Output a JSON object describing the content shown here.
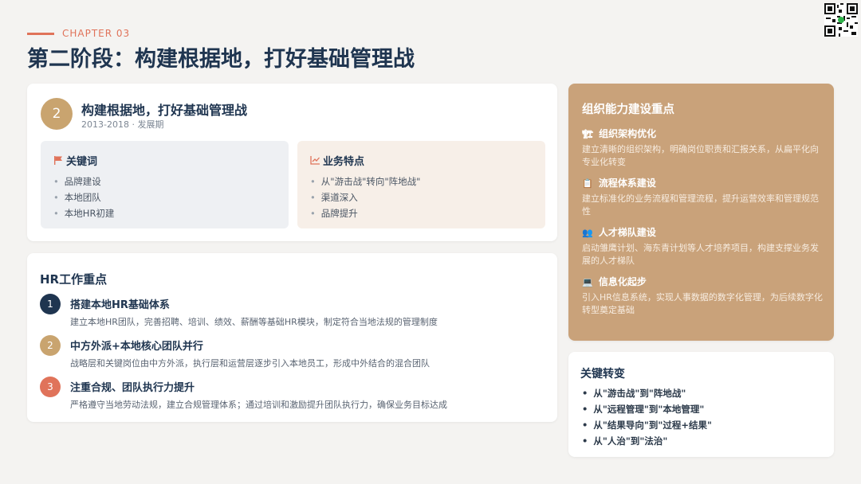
{
  "header": {
    "chapter": "CHAPTER 03",
    "title": "第二阶段：构建根据地，打好基础管理战",
    "accent_color": "#e0735a"
  },
  "stage": {
    "number": "2",
    "title": "构建根据地，打好基础管理战",
    "subtitle": "2013-2018 · 发展期",
    "keywords": {
      "icon": "flag-icon",
      "title": "关键词",
      "items": [
        "品牌建设",
        "本地团队",
        "本地HR初建"
      ]
    },
    "features": {
      "icon": "chart-line-icon",
      "title": "业务特点",
      "items": [
        "从\"游击战\"转向\"阵地战\"",
        "渠道深入",
        "品牌提升"
      ]
    }
  },
  "hr": {
    "title": "HR工作重点",
    "items": [
      {
        "num": "1",
        "color": "#1f3550",
        "title": "搭建本地HR基础体系",
        "desc": "建立本地HR团队，完善招聘、培训、绩效、薪酬等基础HR模块，制定符合当地法规的管理制度"
      },
      {
        "num": "2",
        "color": "#c9a46f",
        "title": "中方外派+本地核心团队并行",
        "desc": "战略层和关键岗位由中方外派，执行层和运营层逐步引入本地员工，形成中外结合的混合团队"
      },
      {
        "num": "3",
        "color": "#e0735a",
        "title": "注重合规、团队执行力提升",
        "desc": "严格遵守当地劳动法规，建立合规管理体系；通过培训和激励提升团队执行力，确保业务目标达成"
      }
    ]
  },
  "org": {
    "title": "组织能力建设重点",
    "background": "#c9a27a",
    "items": [
      {
        "icon": "org-structure-icon",
        "glyph": "🏗",
        "title": "组织架构优化",
        "desc": "建立清晰的组织架构，明确岗位职责和汇报关系，从扁平化向专业化转变"
      },
      {
        "icon": "clipboard-icon",
        "glyph": "📋",
        "title": "流程体系建设",
        "desc": "建立标准化的业务流程和管理流程，提升运营效率和管理规范性"
      },
      {
        "icon": "team-icon",
        "glyph": "👥",
        "title": "人才梯队建设",
        "desc": "启动雏鹰计划、海东青计划等人才培养项目，构建支撑业务发展的人才梯队"
      },
      {
        "icon": "laptop-icon",
        "glyph": "💻",
        "title": "信息化起步",
        "desc": "引入HR信息系统，实现人事数据的数字化管理，为后续数字化转型奠定基础"
      }
    ]
  },
  "key": {
    "title": "关键转变",
    "items": [
      "从\"游击战\"到\"阵地战\"",
      "从\"远程管理\"到\"本地管理\"",
      "从\"结果导向\"到\"过程+结果\"",
      "从\"人治\"到\"法治\""
    ]
  }
}
